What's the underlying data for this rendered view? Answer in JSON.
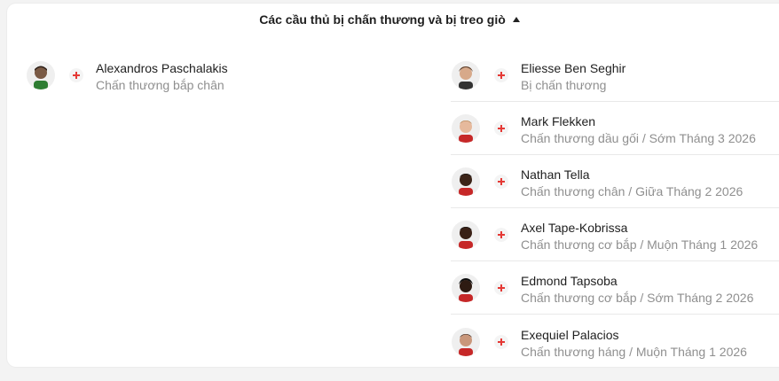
{
  "header": {
    "title": "Các cầu thủ bị chấn thương và bị treo giò"
  },
  "left_players": [
    {
      "name": "Alexandros Paschalakis",
      "status": "Chấn thương bắp chân",
      "icon": "injury-cross-icon"
    }
  ],
  "right_players": [
    {
      "name": "Eliesse Ben Seghir",
      "status": "Bị chấn thương",
      "icon": "injury-cross-icon"
    },
    {
      "name": "Mark Flekken",
      "status": "Chấn thương dầu gối / Sớm Tháng 3 2026",
      "icon": "injury-cross-icon"
    },
    {
      "name": "Nathan Tella",
      "status": "Chấn thương chân / Giữa Tháng 2 2026",
      "icon": "injury-cross-icon"
    },
    {
      "name": "Axel Tape-Kobrissa",
      "status": "Chấn thương cơ bắp / Muộn Tháng 1 2026",
      "icon": "injury-cross-icon"
    },
    {
      "name": "Edmond Tapsoba",
      "status": "Chấn thương cơ bắp / Sớm Tháng 2 2026",
      "icon": "injury-cross-icon"
    },
    {
      "name": "Exequiel Palacios",
      "status": "Chấn thương háng / Muộn Tháng 1 2026",
      "icon": "injury-cross-icon"
    }
  ],
  "colors": {
    "injury_cross": "#e53935",
    "status_text": "#8f8f8f",
    "name_text": "#1f1f1f"
  }
}
